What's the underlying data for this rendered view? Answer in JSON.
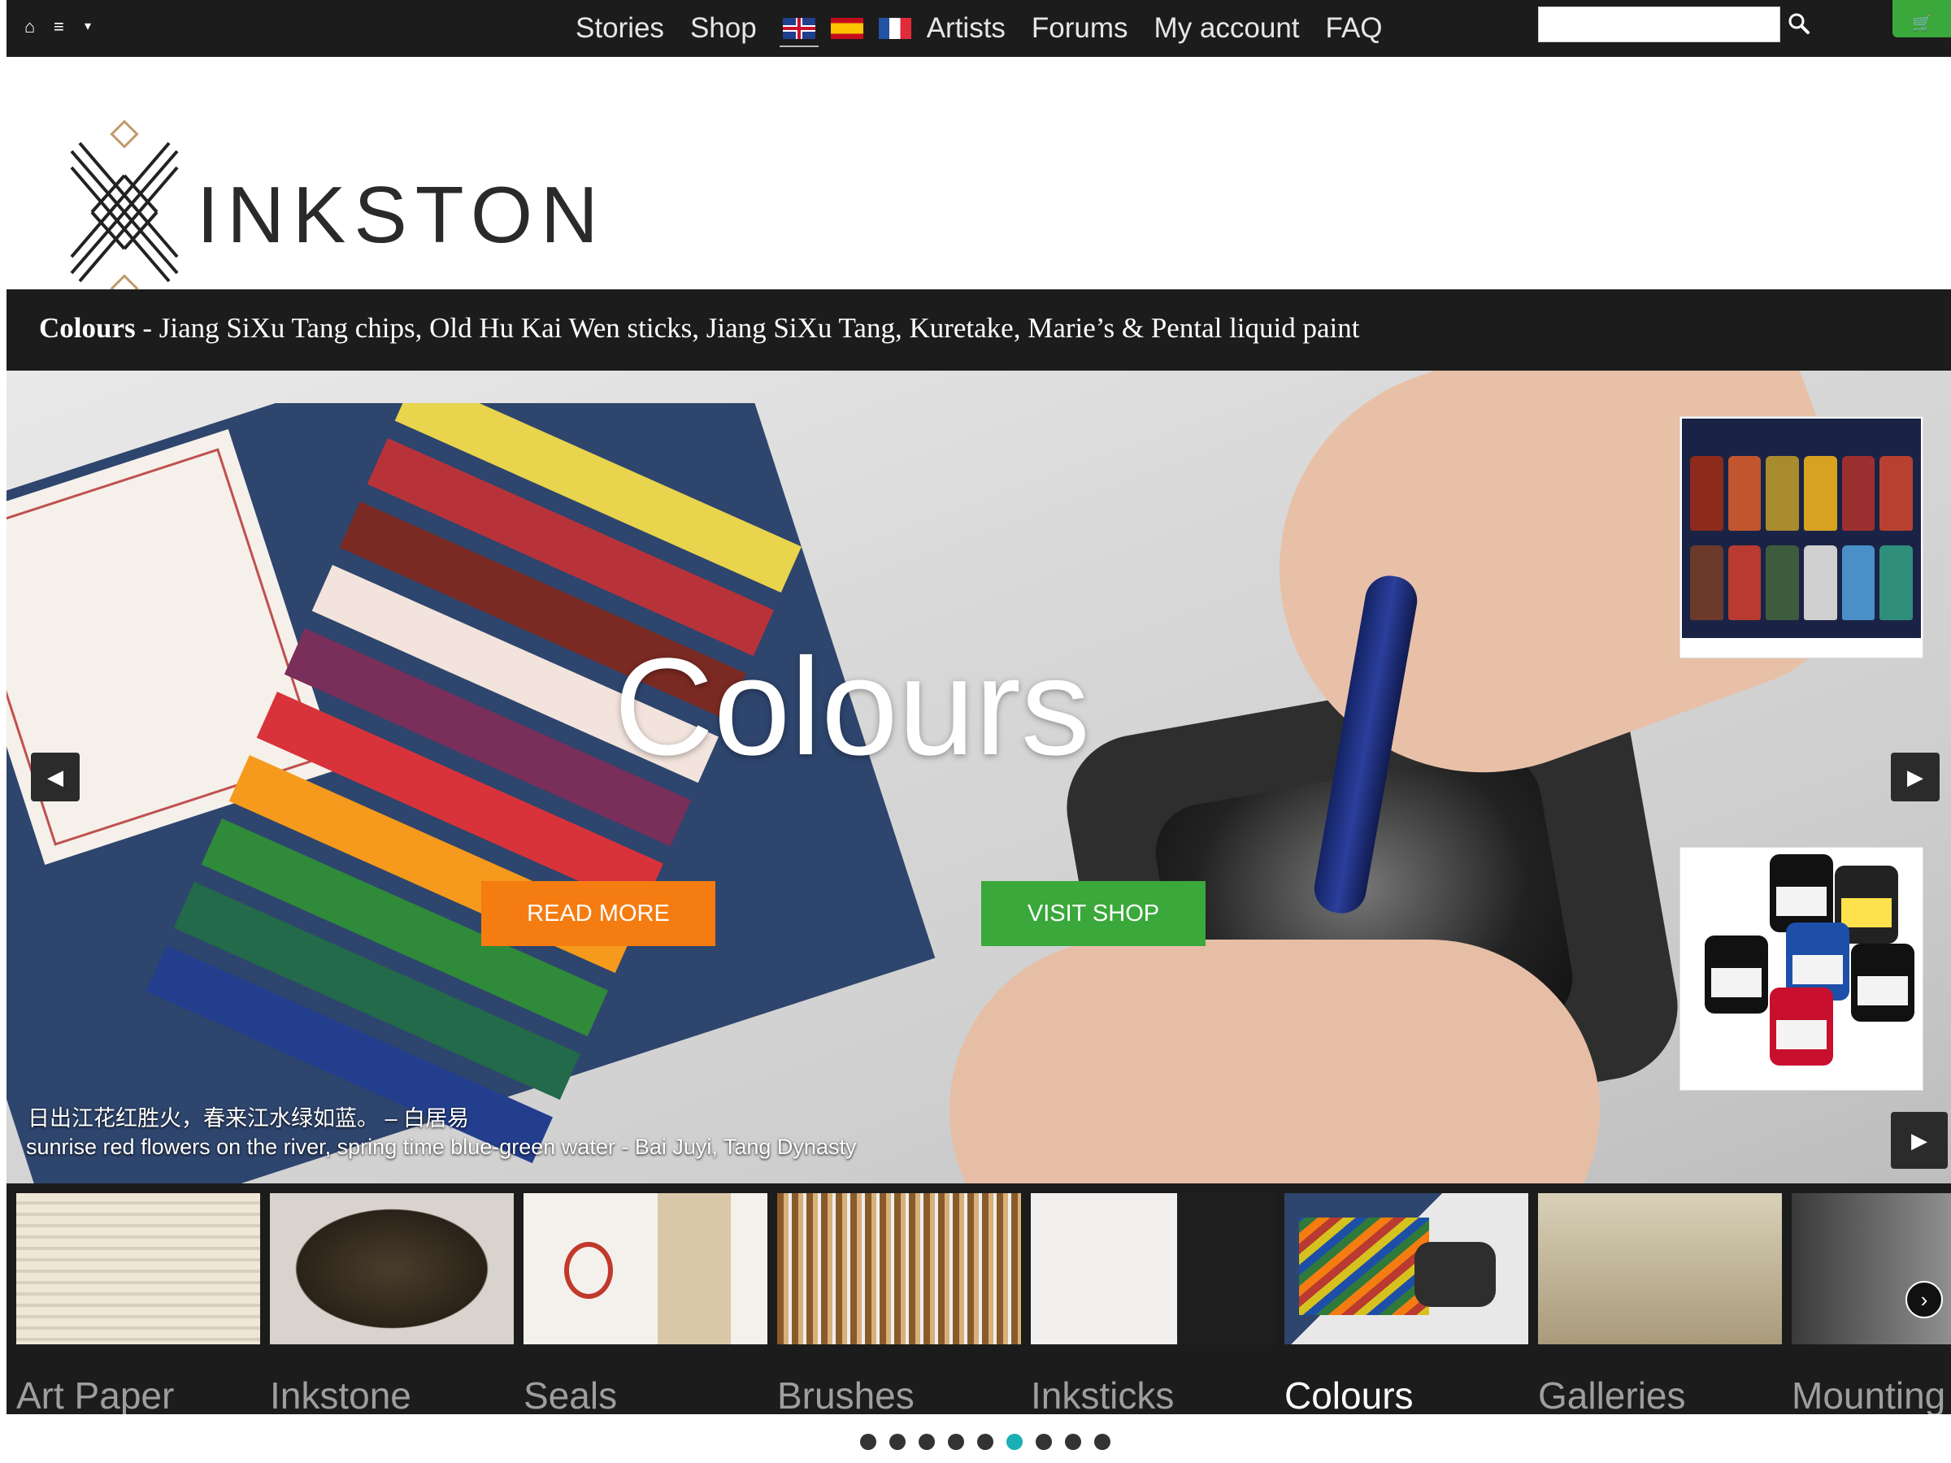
{
  "topbar": {
    "home_icon": "home-icon",
    "menu_icon": "hamburger-menu-icon",
    "caret": "▾",
    "nav": [
      "Stories",
      "Shop",
      "Artists",
      "Forums",
      "My account",
      "FAQ"
    ],
    "flags": [
      "flag-gb-icon",
      "flag-es-icon",
      "flag-fr-icon"
    ],
    "search_value": "",
    "search_icon": "search-icon",
    "cart_icon": "cart-icon"
  },
  "brand": {
    "logo_text": "INKSTON"
  },
  "subtitle": {
    "bold": "Colours",
    "rest": " - Jiang SiXu Tang chips, Old Hu Kai Wen sticks, Jiang SiXu Tang, Kuretake, Marie’s & Pental liquid paint"
  },
  "hero": {
    "title": "Colours",
    "read_more": "READ MORE",
    "visit_shop": "VISIT SHOP",
    "caption_cn": "日出江花红胜火，春来江水绿如蓝。 – 白居易",
    "caption_en": "sunrise red flowers on the river, spring time blue-green water - Bai Juyi, Tang Dynasty",
    "prev_icon": "arrow-left-icon",
    "next_icon": "arrow-right-icon",
    "thumb_next_icon": "play-right-icon"
  },
  "categories": {
    "items": [
      "Art Paper",
      "Inkstone",
      "Seals",
      "Brushes",
      "Inksticks",
      "Colours",
      "Galleries",
      "Mounting"
    ],
    "active": "Colours",
    "next_icon": "chevron-right-icon"
  },
  "pager": {
    "count": 9,
    "active_index": 6
  },
  "colors": {
    "dark_bar": "#1c1c1c",
    "orange": "#f57c11",
    "green": "#3aa83a",
    "teal_dot": "#1aaeb6"
  }
}
